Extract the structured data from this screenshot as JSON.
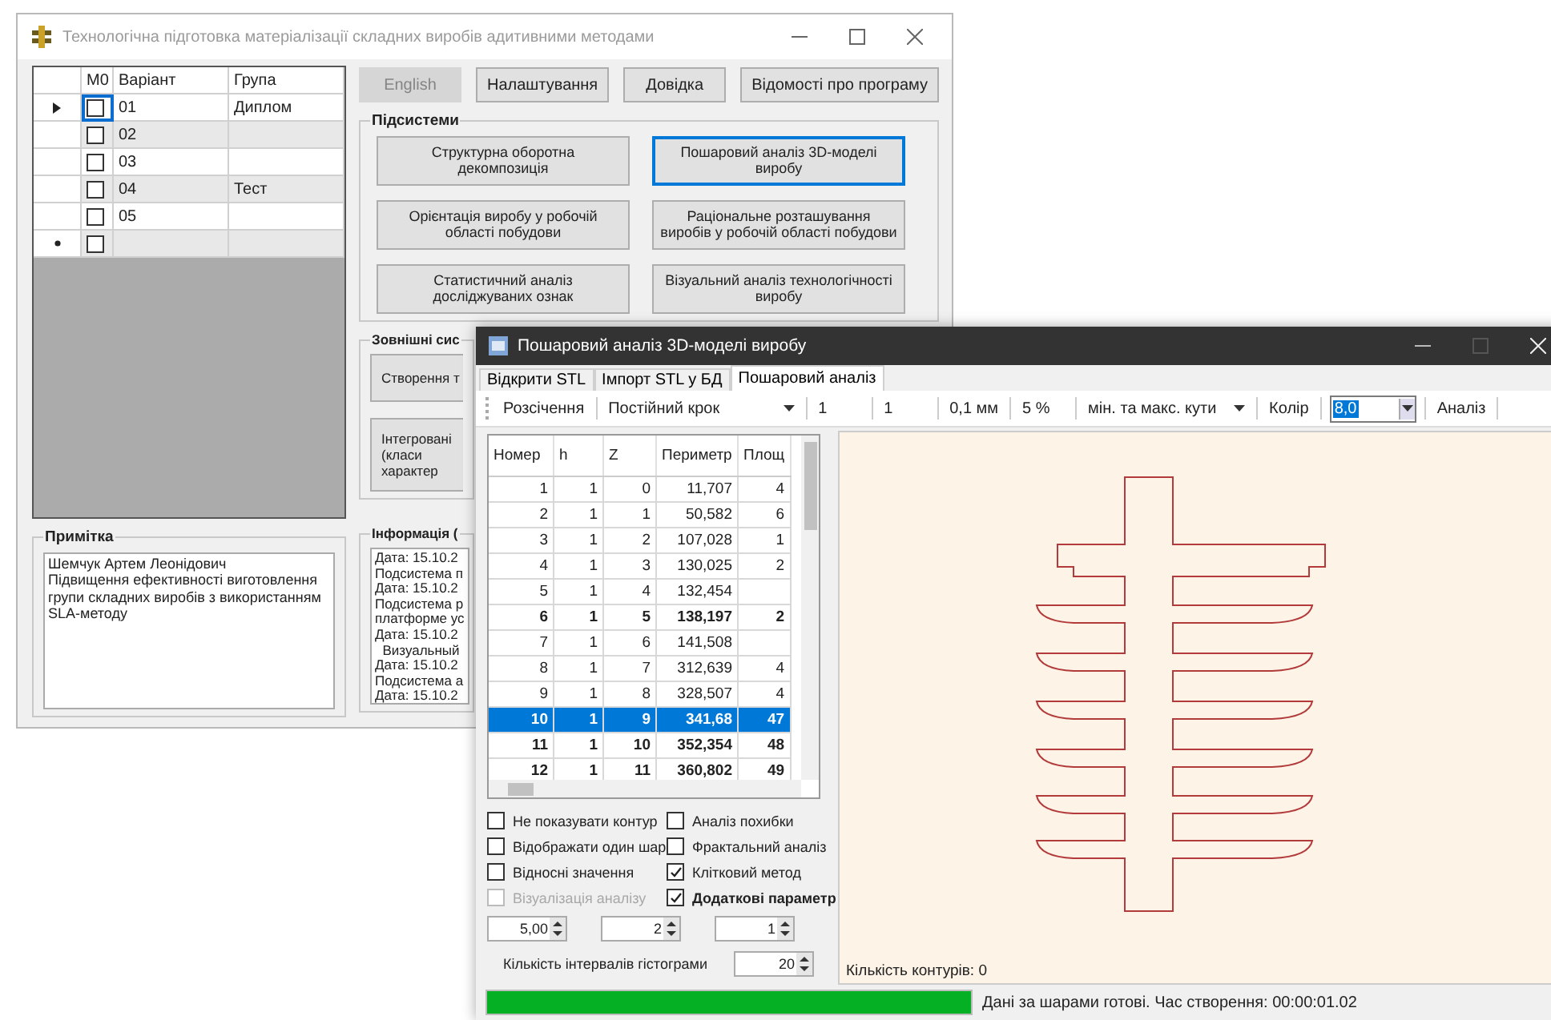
{
  "main_window": {
    "title": "Технологічна підготовка матеріалізації складних виробів адитивними методами",
    "buttons": [
      {
        "label": "English",
        "disabled": true
      },
      {
        "label": "Налаштування",
        "disabled": false
      },
      {
        "label": "Довідка",
        "disabled": false
      },
      {
        "label": "Відомості про програму",
        "disabled": false
      }
    ],
    "variants_table": {
      "columns": [
        "M0",
        "Варіант",
        "Група"
      ],
      "rows": [
        {
          "kind": "current",
          "m0": false,
          "variant": "01",
          "group": "Диплом"
        },
        {
          "kind": "normal",
          "m0": false,
          "variant": "02"
        },
        {
          "kind": "normal",
          "m0": false,
          "variant": "03"
        },
        {
          "kind": "normal",
          "m0": false,
          "variant": "04",
          "group": "Тест"
        },
        {
          "kind": "normal",
          "m0": false,
          "variant": "05"
        },
        {
          "kind": "new",
          "m0": false
        }
      ]
    },
    "subsystems": {
      "title": "Підсистеми",
      "buttons": [
        {
          "label": "Структурна оборотна декомпозиція",
          "focused": false
        },
        {
          "label": "Пошаровий аналіз 3D-моделі виробу",
          "focused": true
        },
        {
          "label": "Орієнтація виробу у робочій області побудови",
          "focused": false
        },
        {
          "label": "Раціональне розташування виробів у робочій області побудови",
          "focused": false
        },
        {
          "label": "Статистичний аналіз досліджуваних ознак",
          "focused": false
        },
        {
          "label": "Візуальний аналіз технологічності виробу",
          "focused": false
        }
      ]
    },
    "external": {
      "title": "Зовнішні сис",
      "buttons": [
        {
          "lines": [
            "Створення т"
          ]
        },
        {
          "lines": [
            "Інтегровані",
            "(класи",
            "характер"
          ]
        }
      ]
    },
    "note": {
      "title": "Примітка",
      "lines": [
        "Шемчук Артем Леонідович",
        "Підвищення ефективності виготовлення групи складних виробів з використанням SLA-методу"
      ]
    },
    "info": {
      "title": "Інформація (",
      "lines": [
        "Дата: 15.10.2",
        "Подсистема п",
        "Дата: 15.10.2",
        "Подсистема р",
        "платформе ус",
        "Дата: 15.10.2",
        "  Визуальный",
        "Дата: 15.10.2",
        "Подсистема а",
        "Дата: 15.10.2"
      ]
    }
  },
  "analysis_window": {
    "title": "Пошаровий аналіз 3D-моделі виробу",
    "tabs": [
      {
        "label": "Відкрити STL",
        "selected": false
      },
      {
        "label": "Імпорт STL у БД",
        "selected": false
      },
      {
        "label": "Пошаровий аналіз",
        "selected": true
      }
    ],
    "toolbar": [
      {
        "kind": "button",
        "text": "Розсічення"
      },
      {
        "kind": "dropdown",
        "text": "Постійний крок"
      },
      {
        "kind": "text",
        "text": "1"
      },
      {
        "kind": "text",
        "text": "1"
      },
      {
        "kind": "text",
        "text": "0,1 мм"
      },
      {
        "kind": "text",
        "text": "5 %"
      },
      {
        "kind": "dropdown",
        "text": "мін. та макс. кути"
      },
      {
        "kind": "label",
        "text": "Колір"
      },
      {
        "kind": "combo",
        "text": "8,0"
      },
      {
        "kind": "button",
        "text": "Аналіз"
      }
    ],
    "layers_table": {
      "columns": [
        "Номер",
        "h",
        "Z",
        "Периметр",
        "Площ"
      ],
      "rows": [
        {
          "cells": [
            "1",
            "1",
            "0",
            "11,707",
            "4"
          ],
          "bold": false,
          "selected": false
        },
        {
          "cells": [
            "2",
            "1",
            "1",
            "50,582",
            "6"
          ],
          "bold": false,
          "selected": false
        },
        {
          "cells": [
            "3",
            "1",
            "2",
            "107,028",
            "1"
          ],
          "bold": false,
          "selected": false
        },
        {
          "cells": [
            "4",
            "1",
            "3",
            "130,025",
            "2"
          ],
          "bold": false,
          "selected": false
        },
        {
          "cells": [
            "5",
            "1",
            "4",
            "132,454",
            ""
          ],
          "bold": false,
          "selected": false
        },
        {
          "cells": [
            "6",
            "1",
            "5",
            "138,197",
            "2"
          ],
          "bold": true,
          "selected": false
        },
        {
          "cells": [
            "7",
            "1",
            "6",
            "141,508",
            ""
          ],
          "bold": false,
          "selected": false
        },
        {
          "cells": [
            "8",
            "1",
            "7",
            "312,639",
            "4"
          ],
          "bold": false,
          "selected": false
        },
        {
          "cells": [
            "9",
            "1",
            "8",
            "328,507",
            "4"
          ],
          "bold": false,
          "selected": false
        },
        {
          "cells": [
            "10",
            "1",
            "9",
            "341,68",
            "47"
          ],
          "bold": true,
          "selected": true
        },
        {
          "cells": [
            "11",
            "1",
            "10",
            "352,354",
            "48"
          ],
          "bold": true,
          "selected": false
        },
        {
          "cells": [
            "12",
            "1",
            "11",
            "360,802",
            "49"
          ],
          "bold": true,
          "selected": false
        }
      ]
    },
    "options": [
      {
        "label": "Не показувати контур",
        "checked": false,
        "disabled": false,
        "bold": false
      },
      {
        "label": "Аналіз похибки",
        "checked": false,
        "disabled": false,
        "bold": false
      },
      {
        "label": "Відображати один шар",
        "checked": false,
        "disabled": false,
        "bold": false
      },
      {
        "label": "Фрактальний аналіз",
        "checked": false,
        "disabled": false,
        "bold": false
      },
      {
        "label": "Відносні значення",
        "checked": false,
        "disabled": false,
        "bold": false
      },
      {
        "label": "Клітковий метод",
        "checked": true,
        "disabled": false,
        "bold": false
      },
      {
        "label": "Візуалізація аналізу",
        "checked": false,
        "disabled": true,
        "bold": false
      },
      {
        "label": "Додаткові параметр",
        "checked": true,
        "disabled": false,
        "bold": true
      }
    ],
    "spinners": [
      "5,00",
      "2",
      "1"
    ],
    "histogram": {
      "label": "Кількість інтервалів гістограми",
      "value": "20"
    },
    "contour_count": "Кількість контурів: 0",
    "status": {
      "level": 1,
      "text": "Дані за шарами готові. Час створення: 00:00:01.02"
    }
  }
}
